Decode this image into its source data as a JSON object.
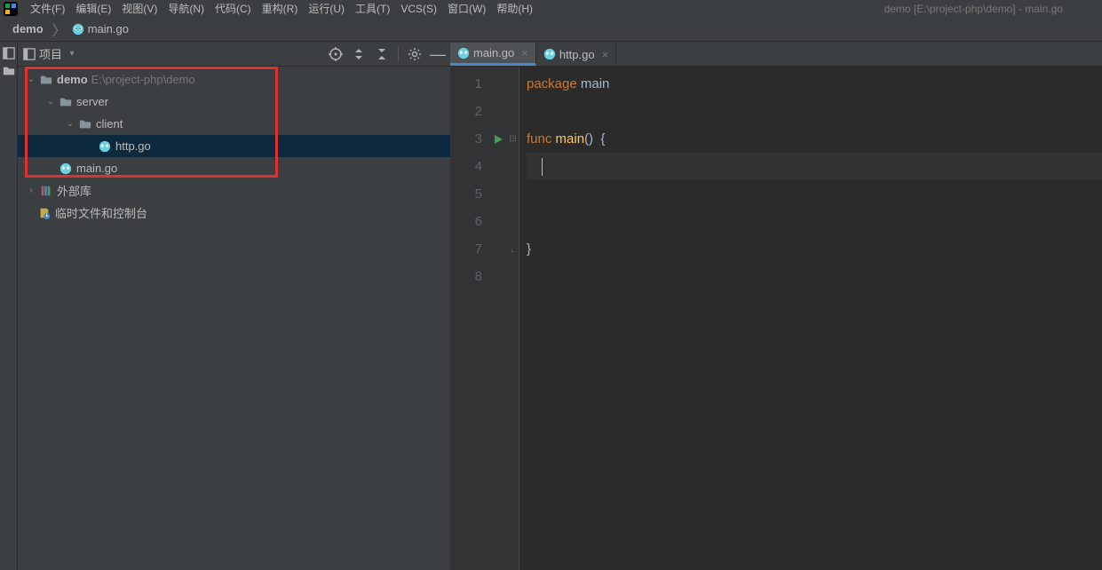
{
  "title": "demo [E:\\project-php\\demo] - main.go",
  "menu": [
    {
      "label": "文件(F)",
      "name": "menu-file"
    },
    {
      "label": "编辑(E)",
      "name": "menu-edit"
    },
    {
      "label": "视图(V)",
      "name": "menu-view"
    },
    {
      "label": "导航(N)",
      "name": "menu-navigate"
    },
    {
      "label": "代码(C)",
      "name": "menu-code"
    },
    {
      "label": "重构(R)",
      "name": "menu-refactor"
    },
    {
      "label": "运行(U)",
      "name": "menu-run"
    },
    {
      "label": "工具(T)",
      "name": "menu-tools"
    },
    {
      "label": "VCS(S)",
      "name": "menu-vcs"
    },
    {
      "label": "窗口(W)",
      "name": "menu-window"
    },
    {
      "label": "帮助(H)",
      "name": "menu-help"
    }
  ],
  "breadcrumbs": {
    "project": "demo",
    "file": "main.go"
  },
  "sidebar": {
    "title": "项目",
    "tree": {
      "root": {
        "label": "demo",
        "path": "E:\\project-php\\demo"
      },
      "server": "server",
      "client": "client",
      "http_go": "http.go",
      "main_go": "main.go",
      "external": "外部库",
      "scratch": "临时文件和控制台"
    }
  },
  "editor": {
    "tabs": [
      {
        "label": "main.go",
        "active": true
      },
      {
        "label": "http.go",
        "active": false
      }
    ],
    "lines": [
      "1",
      "2",
      "3",
      "4",
      "5",
      "6",
      "7",
      "8"
    ],
    "code": {
      "l1": {
        "kw": "package",
        "id": " main"
      },
      "l3": {
        "kw": "func",
        "fn": " main",
        "paren": "()  ",
        "brace": "{"
      },
      "l7": {
        "brace": "}"
      }
    }
  }
}
